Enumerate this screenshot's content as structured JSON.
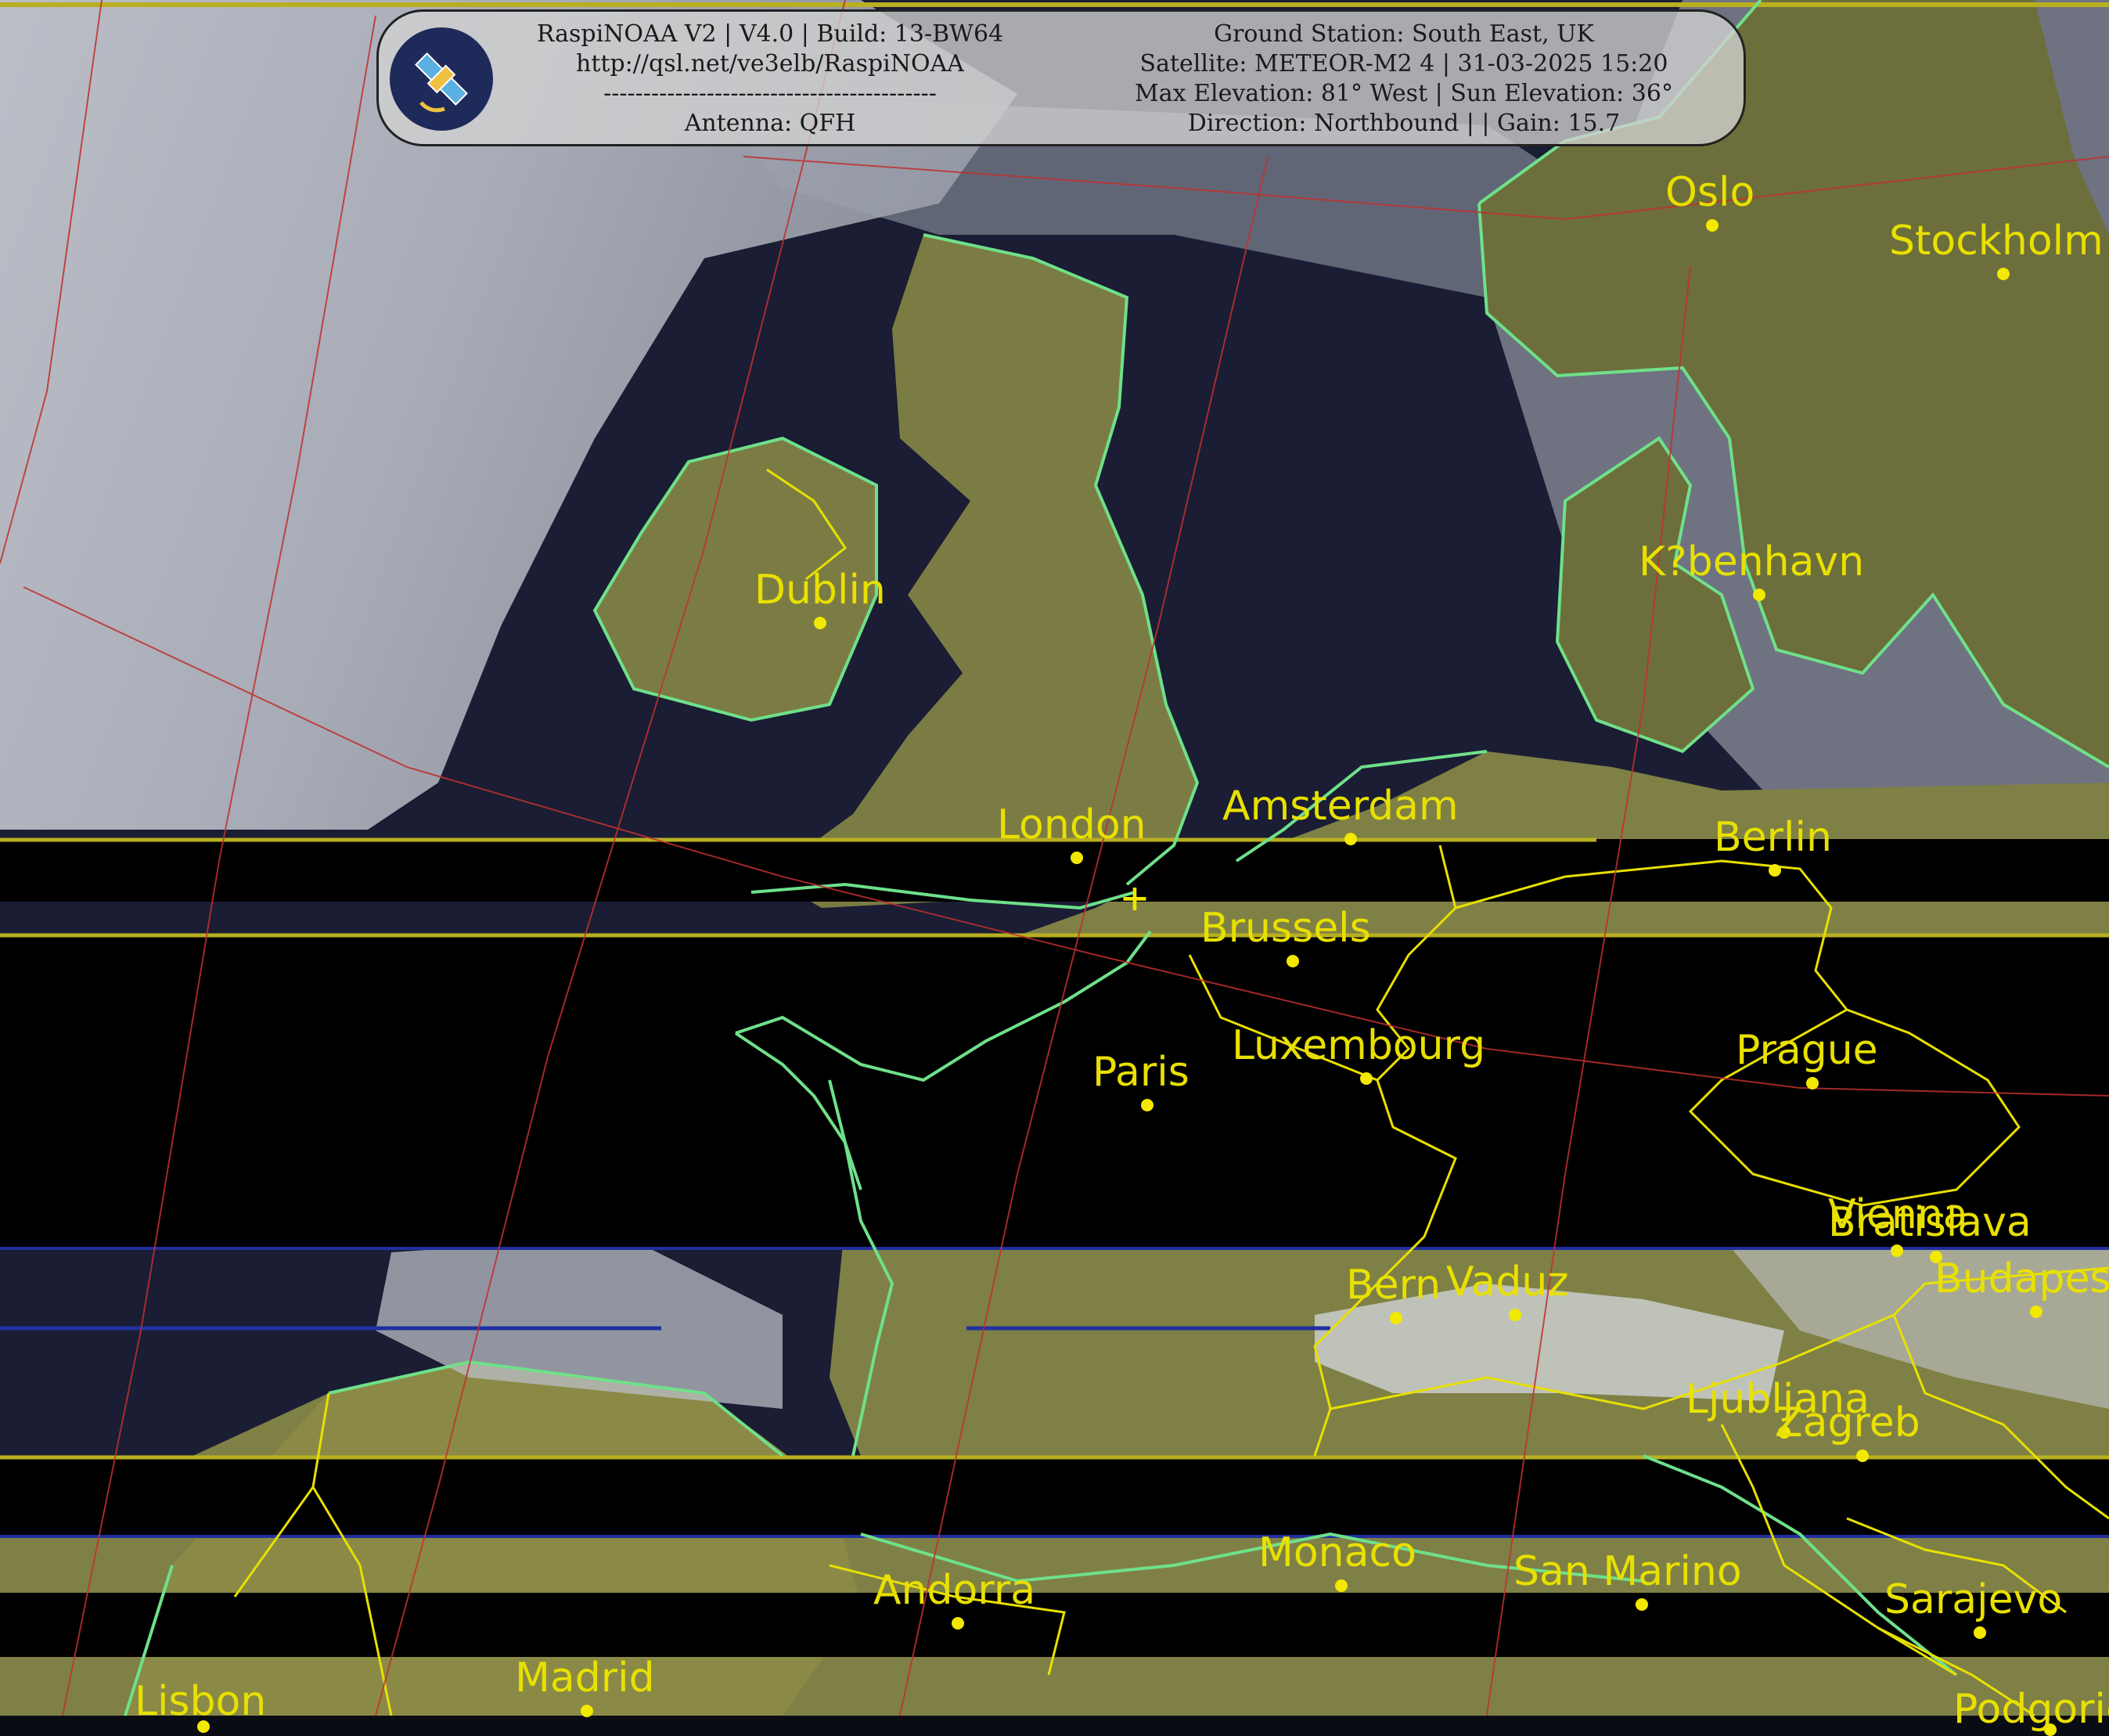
{
  "header": {
    "software": "RaspiNOAA V2 | V4.0 | Build: 13-BW64",
    "url": "http://qsl.net/ve3elb/RaspiNOAA",
    "separator": "------------------------------------------",
    "antenna": "Antenna: QFH",
    "ground_station": "Ground Station: South East, UK",
    "satellite": "Satellite: METEOR-M2 4 | 31-03-2025 15:20",
    "elevation": "Max Elevation: 81° West | Sun Elevation: 36°",
    "direction": "Direction: Northbound | | Gain: 15.7",
    "logo_icon": "satellite-icon"
  },
  "colors": {
    "city": "#e8e000",
    "coastline": "#6fe08a",
    "border": "#e8e000",
    "grid": "#d03030",
    "cloud": "#d8dce4",
    "sea": "#1a1d33",
    "land": "#8a8a40"
  },
  "cities": [
    {
      "name": "Oslo"
    },
    {
      "name": "Stockholm"
    },
    {
      "name": "Dublin"
    },
    {
      "name": "K?benhavn"
    },
    {
      "name": "London"
    },
    {
      "name": "Amsterdam"
    },
    {
      "name": "Berlin"
    },
    {
      "name": "Brussels"
    },
    {
      "name": "Paris"
    },
    {
      "name": "Luxembourg"
    },
    {
      "name": "Prague"
    },
    {
      "name": "Vienna"
    },
    {
      "name": "Bratislava"
    },
    {
      "name": "Bern"
    },
    {
      "name": "Vaduz"
    },
    {
      "name": "Budapest"
    },
    {
      "name": "Ljubljana"
    },
    {
      "name": "Zagreb"
    },
    {
      "name": "Monaco"
    },
    {
      "name": "San Marino"
    },
    {
      "name": "Andorra"
    },
    {
      "name": "Sarajevo"
    },
    {
      "name": "Madrid"
    },
    {
      "name": "Lisbon"
    },
    {
      "name": "Podgorica"
    }
  ],
  "ground_station_marker_icon": "crosshair-icon"
}
